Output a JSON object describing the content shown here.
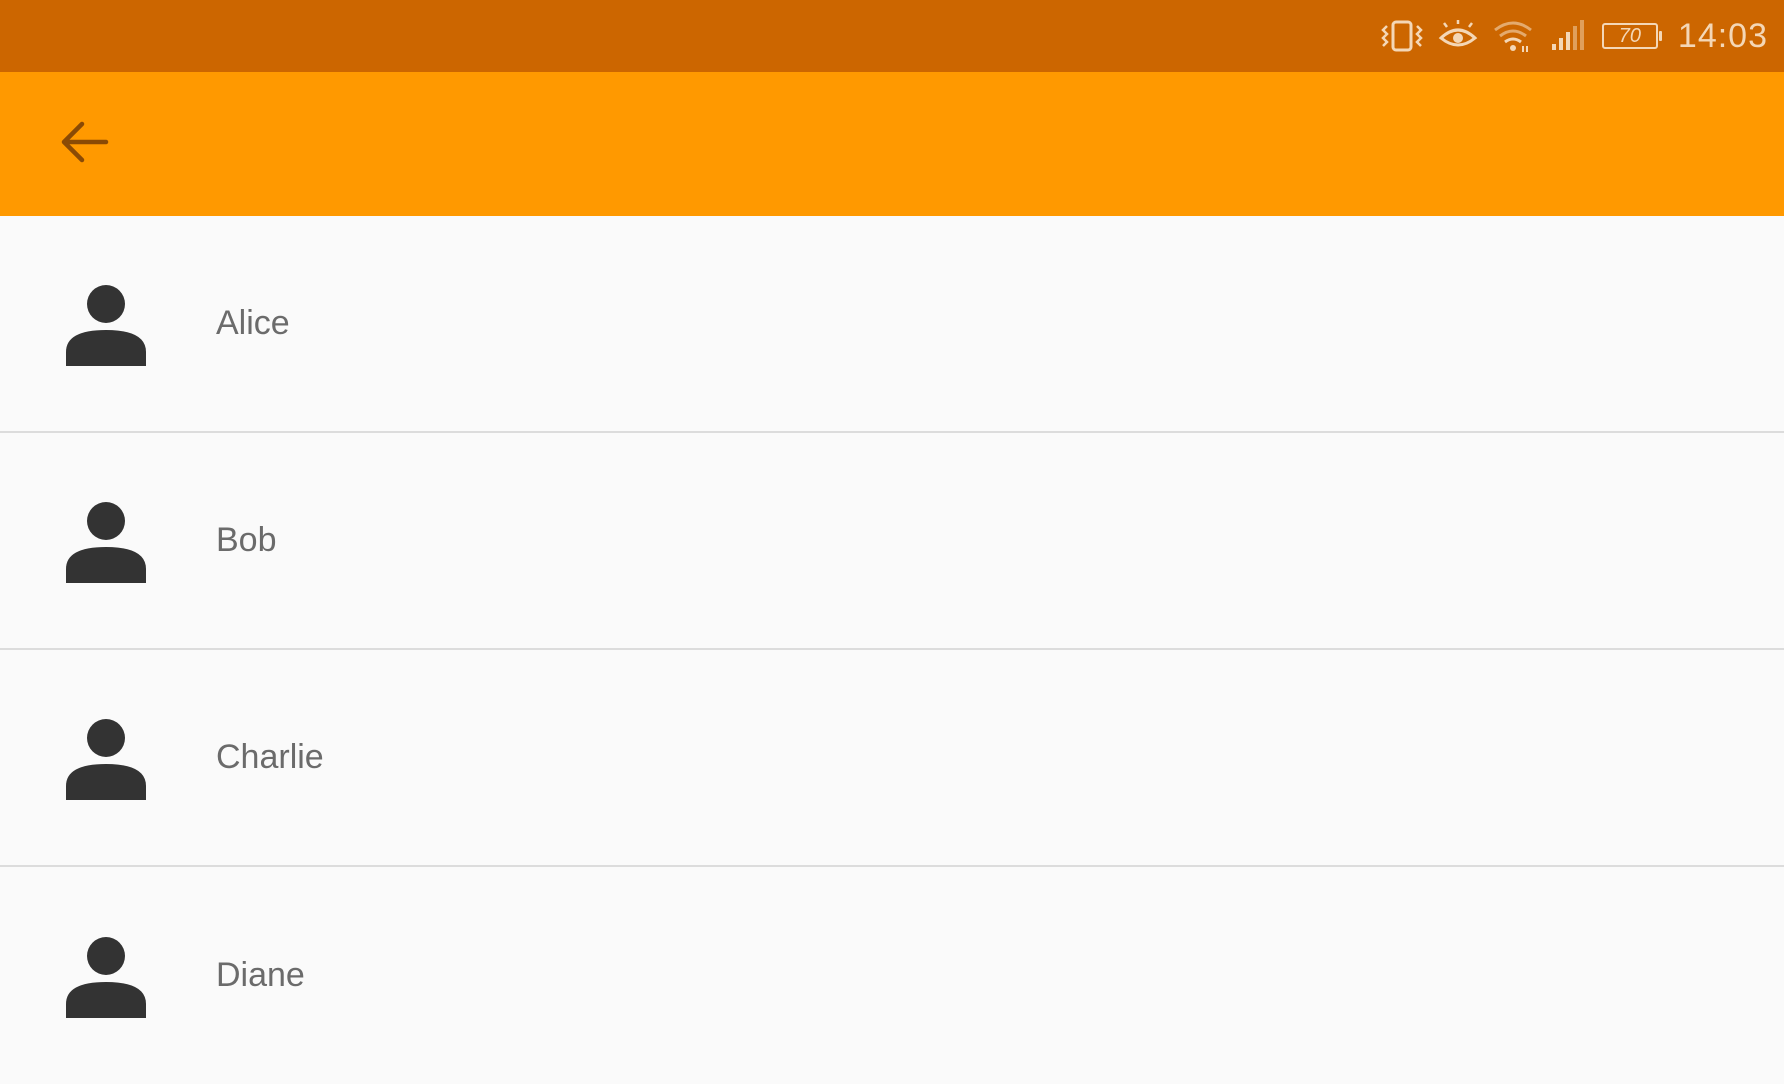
{
  "status_bar": {
    "icons": [
      "vibrate-icon",
      "eye-comfort-icon",
      "wifi-icon",
      "cell-signal-icon"
    ],
    "battery_level": "70",
    "time": "14:03"
  },
  "app_bar": {
    "back_icon": "arrow-back-icon"
  },
  "contacts": [
    {
      "name": "Alice",
      "icon": "person-icon"
    },
    {
      "name": "Bob",
      "icon": "person-icon"
    },
    {
      "name": "Charlie",
      "icon": "person-icon"
    },
    {
      "name": "Diane",
      "icon": "person-icon"
    }
  ],
  "colors": {
    "status_bar": "#cc6600",
    "app_bar": "#ff9900",
    "background": "#fafafa",
    "divider": "#dcdcdc",
    "avatar": "#333333",
    "label": "#6b6b6b"
  }
}
